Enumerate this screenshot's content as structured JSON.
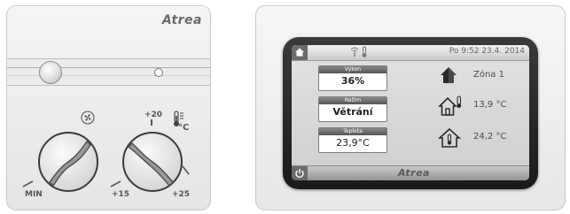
{
  "left_panel": {
    "brand": "Atrea",
    "fan_knob_min_label": "MIN",
    "temp_scale_top": "+20",
    "temp_unit": "°C",
    "temp_scale_left": "+15",
    "temp_scale_right": "+25"
  },
  "right_panel": {
    "datetime": "Po 9:52  23.4. 2014",
    "cards": [
      {
        "label": "Výkon",
        "value": "36%"
      },
      {
        "label": "Režim",
        "value": "Větrání"
      },
      {
        "label": "Teplota",
        "value": "23,9°C"
      }
    ],
    "zones": [
      {
        "text": "Zóna 1",
        "icon": "zone-house-icon"
      },
      {
        "text": "13,9 °C",
        "icon": "outdoor-temperature-house-icon"
      },
      {
        "text": "24,2 °C",
        "icon": "indoor-temperature-house-icon"
      }
    ],
    "brand": "Atrea"
  }
}
